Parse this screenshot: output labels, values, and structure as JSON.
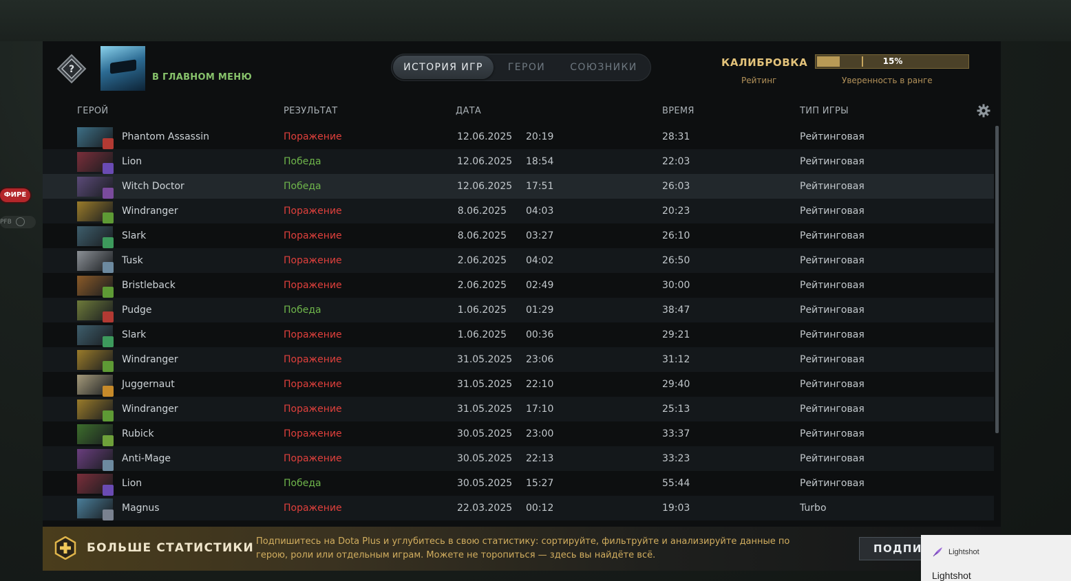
{
  "side": {
    "badge": "ФИРЕ",
    "badge2": "PFB"
  },
  "header": {
    "main_menu": "В ГЛАВНОМ МЕНЮ",
    "tabs": [
      {
        "label": "ИСТОРИЯ ИГР",
        "active": true
      },
      {
        "label": "ГЕРОИ",
        "active": false
      },
      {
        "label": "СОЮЗНИКИ",
        "active": false
      }
    ],
    "calibration": "КАЛИБРОВКА",
    "rating_label": "Рейтинг",
    "progress_text": "15%",
    "progress_value": 0.15,
    "confidence_label": "Уверенность в ранге"
  },
  "columns": {
    "hero": "ГЕРОЙ",
    "result": "РЕЗУЛЬТАТ",
    "date": "ДАТА",
    "duration": "ВРЕМЯ",
    "mode": "ТИП ИГРЫ"
  },
  "matches": [
    {
      "hero": "Phantom Assassin",
      "result": "Поражение",
      "win": false,
      "date": "12.06.2025",
      "time": "20:19",
      "duration": "28:31",
      "mode": "Рейтинговая",
      "color": "#3d6f86",
      "role": "#b23a33"
    },
    {
      "hero": "Lion",
      "result": "Победа",
      "win": true,
      "date": "12.06.2025",
      "time": "18:54",
      "duration": "22:03",
      "mode": "Рейтинговая",
      "color": "#7a2e3a",
      "role": "#6a4bb3"
    },
    {
      "hero": "Witch Doctor",
      "result": "Победа",
      "win": true,
      "date": "12.06.2025",
      "time": "17:51",
      "duration": "26:03",
      "mode": "Рейтинговая",
      "color": "#5b4a78",
      "role": "#7a4b9c"
    },
    {
      "hero": "Windranger",
      "result": "Поражение",
      "win": false,
      "date": "8.06.2025",
      "time": "04:03",
      "duration": "20:23",
      "mode": "Рейтинговая",
      "color": "#9a7b2a",
      "role": "#5e9a35"
    },
    {
      "hero": "Slark",
      "result": "Поражение",
      "win": false,
      "date": "8.06.2025",
      "time": "03:27",
      "duration": "26:10",
      "mode": "Рейтинговая",
      "color": "#3e5e6c",
      "role": "#3d9a5c"
    },
    {
      "hero": "Tusk",
      "result": "Поражение",
      "win": false,
      "date": "2.06.2025",
      "time": "04:02",
      "duration": "26:50",
      "mode": "Рейтинговая",
      "color": "#8b9096",
      "role": "#6d8aa0"
    },
    {
      "hero": "Bristleback",
      "result": "Поражение",
      "win": false,
      "date": "2.06.2025",
      "time": "02:49",
      "duration": "30:00",
      "mode": "Рейтинговая",
      "color": "#8a5a28",
      "role": "#5e9a35"
    },
    {
      "hero": "Pudge",
      "result": "Победа",
      "win": true,
      "date": "1.06.2025",
      "time": "01:29",
      "duration": "38:47",
      "mode": "Рейтинговая",
      "color": "#6d7a3a",
      "role": "#b23a33"
    },
    {
      "hero": "Slark",
      "result": "Поражение",
      "win": false,
      "date": "1.06.2025",
      "time": "00:36",
      "duration": "29:21",
      "mode": "Рейтинговая",
      "color": "#3e5e6c",
      "role": "#3d9a5c"
    },
    {
      "hero": "Windranger",
      "result": "Поражение",
      "win": false,
      "date": "31.05.2025",
      "time": "23:06",
      "duration": "31:12",
      "mode": "Рейтинговая",
      "color": "#9a7b2a",
      "role": "#5e9a35"
    },
    {
      "hero": "Juggernaut",
      "result": "Поражение",
      "win": false,
      "date": "31.05.2025",
      "time": "22:10",
      "duration": "29:40",
      "mode": "Рейтинговая",
      "color": "#a59a7a",
      "role": "#c68a2a"
    },
    {
      "hero": "Windranger",
      "result": "Поражение",
      "win": false,
      "date": "31.05.2025",
      "time": "17:10",
      "duration": "25:13",
      "mode": "Рейтинговая",
      "color": "#9a7b2a",
      "role": "#5e9a35"
    },
    {
      "hero": "Rubick",
      "result": "Поражение",
      "win": false,
      "date": "30.05.2025",
      "time": "23:00",
      "duration": "33:37",
      "mode": "Рейтинговая",
      "color": "#3d6e2c",
      "role": "#6ea03a"
    },
    {
      "hero": "Anti-Mage",
      "result": "Поражение",
      "win": false,
      "date": "30.05.2025",
      "time": "22:13",
      "duration": "33:23",
      "mode": "Рейтинговая",
      "color": "#6a3e7e",
      "role": "#6d8aa0"
    },
    {
      "hero": "Lion",
      "result": "Победа",
      "win": true,
      "date": "30.05.2025",
      "time": "15:27",
      "duration": "55:44",
      "mode": "Рейтинговая",
      "color": "#7a2e3a",
      "role": "#6a4bb3"
    },
    {
      "hero": "Magnus",
      "result": "Поражение",
      "win": false,
      "date": "22.03.2025",
      "time": "00:12",
      "duration": "19:03",
      "mode": "Turbo",
      "color": "#4a7e9a",
      "role": "#7a8290"
    }
  ],
  "promo": {
    "title": "БОЛЬШЕ СТАТИСТИКИ",
    "text": "Подпишитесь на Dota Plus и углубитесь в свою статистику: сортируйте, фильтруйте и анализируйте данные по герою, роли или отдельным играм. Можете не торопиться — здесь вы найдёте всё.",
    "button": "ПОДПИ"
  },
  "lightshot": {
    "small": "Lightshot",
    "big": "Lightshot"
  }
}
